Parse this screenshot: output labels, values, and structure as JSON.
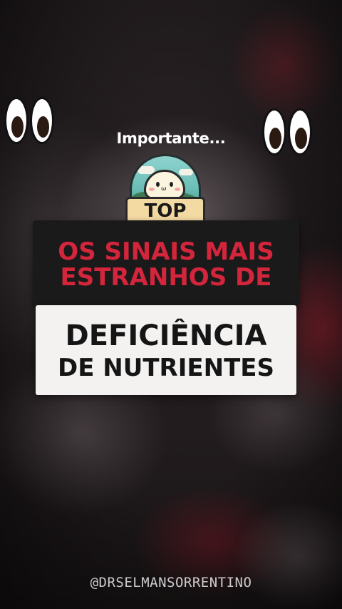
{
  "overlay": {
    "subtitle": "Importante...",
    "badge_label": "TOP",
    "headline_line1": "OS SINAIS MAIS",
    "headline_line2": "ESTRANHOS DE",
    "topic_line1": "DEFICIÊNCIA",
    "topic_line2": "DE NUTRIENTES",
    "handle": "@DRSELMANSORRENTINO"
  },
  "icons": {
    "eyes_left": "eyes-emoji",
    "eyes_right": "eyes-emoji",
    "badge_mascot": "smiling-mascot-icon"
  },
  "colors": {
    "headline_text": "#d3253b",
    "headline_bg": "#1b1a1b",
    "topic_bg": "#f3f2f1",
    "topic_text": "#151515"
  }
}
